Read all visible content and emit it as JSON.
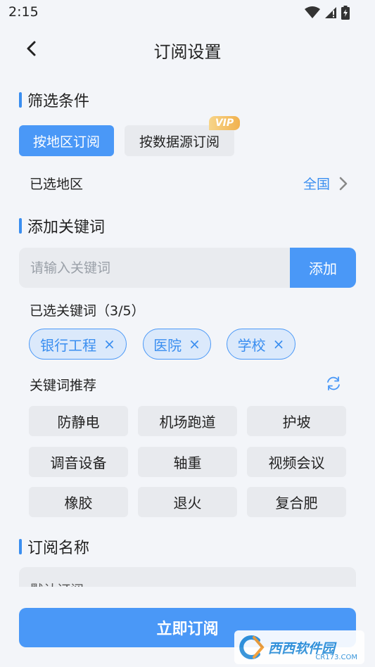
{
  "status": {
    "time": "2:15"
  },
  "header": {
    "title": "订阅设置"
  },
  "filter": {
    "section_title": "筛选条件",
    "tabs": [
      {
        "label": "按地区订阅",
        "active": true
      },
      {
        "label": "按数据源订阅",
        "active": false,
        "badge": "VIP"
      }
    ],
    "region_label": "已选地区",
    "region_value": "全国"
  },
  "keywords": {
    "section_title": "添加关键词",
    "input_placeholder": "请输入关键词",
    "add_button": "添加",
    "selected_label": "已选关键词（3/5）",
    "selected": [
      "银行工程",
      "医院",
      "学校"
    ],
    "recommend_label": "关键词推荐",
    "recommendations": [
      "防静电",
      "机场跑道",
      "护坡",
      "调音设备",
      "轴重",
      "视频会议",
      "橡胶",
      "退火",
      "复合肥"
    ]
  },
  "subscription_name": {
    "section_title": "订阅名称",
    "value": "默认订阅"
  },
  "submit_button": "立即订阅",
  "watermark": {
    "text": "西西软件园",
    "sub": "CR173.COM"
  },
  "colors": {
    "accent": "#4a98f7",
    "vip": "#f1b14e"
  }
}
